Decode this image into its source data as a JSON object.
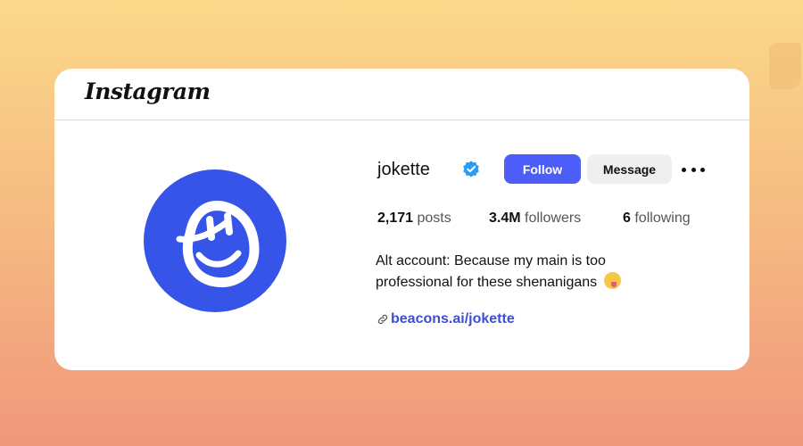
{
  "header": {
    "brand": "Instagram"
  },
  "profile": {
    "username": "jokette",
    "verified": true,
    "follow_label": "Follow",
    "message_label": "Message",
    "stats": {
      "posts_count": "2,171",
      "posts_label": "posts",
      "followers_count": "3.4M",
      "followers_label": "followers",
      "following_count": "6",
      "following_label": "following"
    },
    "bio_line1": "Alt account: Because my main is too",
    "bio_line2": "professional for these shenanigans",
    "bio_emoji": "zany-face-emoji",
    "link": "beacons.ai/jokette"
  },
  "colors": {
    "accent": "#4c5ef7",
    "avatar_bg": "#3654e7",
    "verified": "#2c9bf0",
    "link": "#3a4fd6"
  },
  "icons": [
    "verified-badge-icon",
    "more-options-icon",
    "link-icon",
    "smiley-avatar-icon"
  ]
}
